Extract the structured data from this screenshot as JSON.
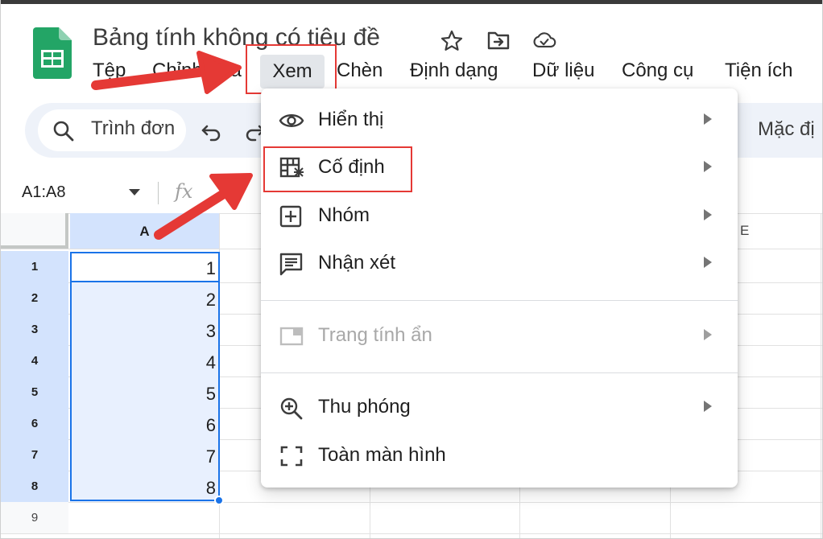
{
  "document": {
    "title": "Bảng tính không có tiêu đề"
  },
  "menu_bar": {
    "items": [
      {
        "label": "Tệp"
      },
      {
        "label": "Chỉnh sửa"
      },
      {
        "label": "Xem"
      },
      {
        "label": "Chèn"
      },
      {
        "label": "Định dạng"
      },
      {
        "label": "Dữ liệu"
      },
      {
        "label": "Công cụ"
      },
      {
        "label": "Tiện ích"
      }
    ],
    "active": "Xem"
  },
  "toolbar": {
    "search_label": "Trình đơn",
    "font_label": "Mặc đị"
  },
  "formula_bar": {
    "name_box": "A1:A8",
    "fx_label": "fx"
  },
  "grid": {
    "column_headers": {
      "a": "A",
      "e": "E"
    },
    "rows": [
      {
        "num": "1",
        "a": "1"
      },
      {
        "num": "2",
        "a": "2"
      },
      {
        "num": "3",
        "a": "3"
      },
      {
        "num": "4",
        "a": "4"
      },
      {
        "num": "5",
        "a": "5"
      },
      {
        "num": "6",
        "a": "6"
      },
      {
        "num": "7",
        "a": "7"
      },
      {
        "num": "8",
        "a": "8"
      },
      {
        "num": "9",
        "a": ""
      }
    ],
    "selection": "A1:A8"
  },
  "view_menu": {
    "items": [
      {
        "label": "Hiển thị",
        "icon": "eye-icon",
        "has_submenu": true,
        "disabled": false
      },
      {
        "label": "Cố định",
        "icon": "freeze-icon",
        "has_submenu": true,
        "disabled": false,
        "highlighted": true
      },
      {
        "label": "Nhóm",
        "icon": "group-plus-icon",
        "has_submenu": true,
        "disabled": false
      },
      {
        "label": "Nhận xét",
        "icon": "comment-icon",
        "has_submenu": true,
        "disabled": false
      },
      {
        "label": "Trang tính ẩn",
        "icon": "hidden-sheet-icon",
        "has_submenu": true,
        "disabled": true
      },
      {
        "label": "Thu phóng",
        "icon": "zoom-icon",
        "has_submenu": true,
        "disabled": false
      },
      {
        "label": "Toàn màn hình",
        "icon": "fullscreen-icon",
        "has_submenu": false,
        "disabled": false
      }
    ]
  },
  "colors": {
    "sheets_green": "#23a566",
    "selection_blue": "#1a73e8",
    "selection_fill": "#e8f0fe",
    "header_selected": "#d3e3fd",
    "annotation_red": "#e53935"
  }
}
